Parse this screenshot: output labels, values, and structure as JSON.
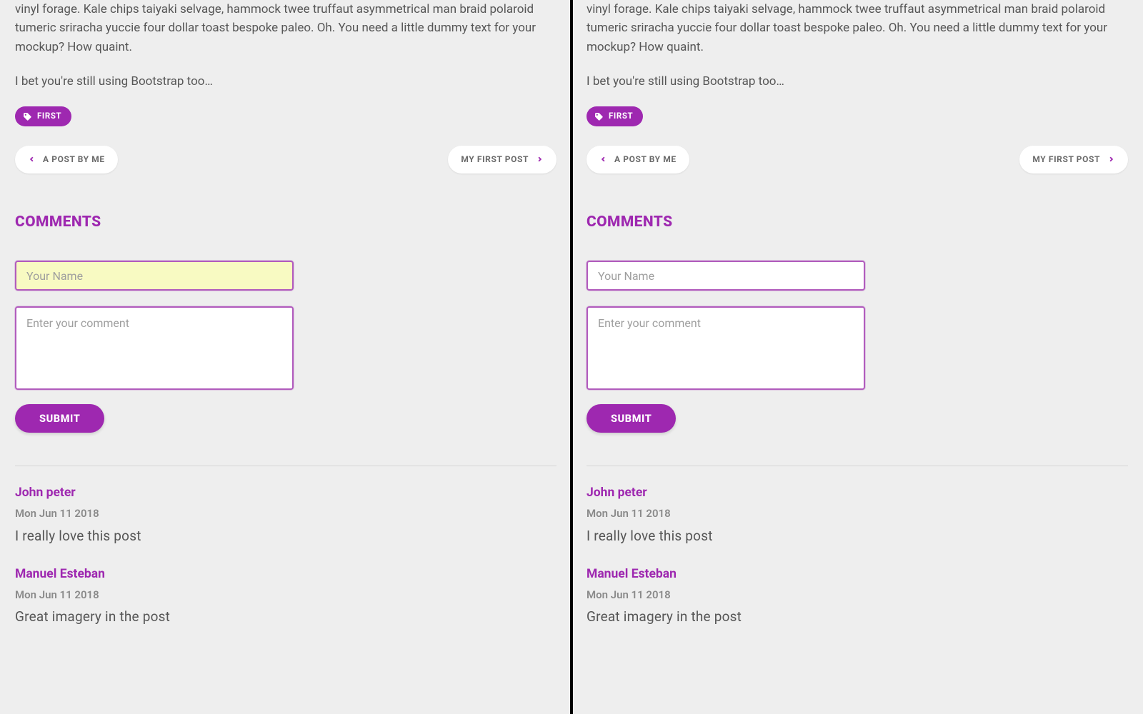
{
  "post_text_1": "vinyl forage. Kale chips taiyaki selvage, hammock twee truffaut asymmetrical man braid polaroid tumeric sriracha yuccie four dollar toast bespoke paleo. Oh. You need a little dummy text for your mockup? How quaint.",
  "post_text_2": "I bet you're still using Bootstrap too…",
  "tag_label": "FIRST",
  "prev_label": "A POST BY ME",
  "next_label": "MY FIRST POST",
  "comments_heading": "COMMENTS",
  "name_placeholder": "Your Name",
  "comment_placeholder": "Enter your comment",
  "submit_label": "SUBMIT",
  "comments": [
    {
      "name": "John peter",
      "date": "Mon Jun 11 2018",
      "text": "I really love this post"
    },
    {
      "name": "Manuel Esteban",
      "date": "Mon Jun 11 2018",
      "text": "Great imagery in the post"
    }
  ]
}
